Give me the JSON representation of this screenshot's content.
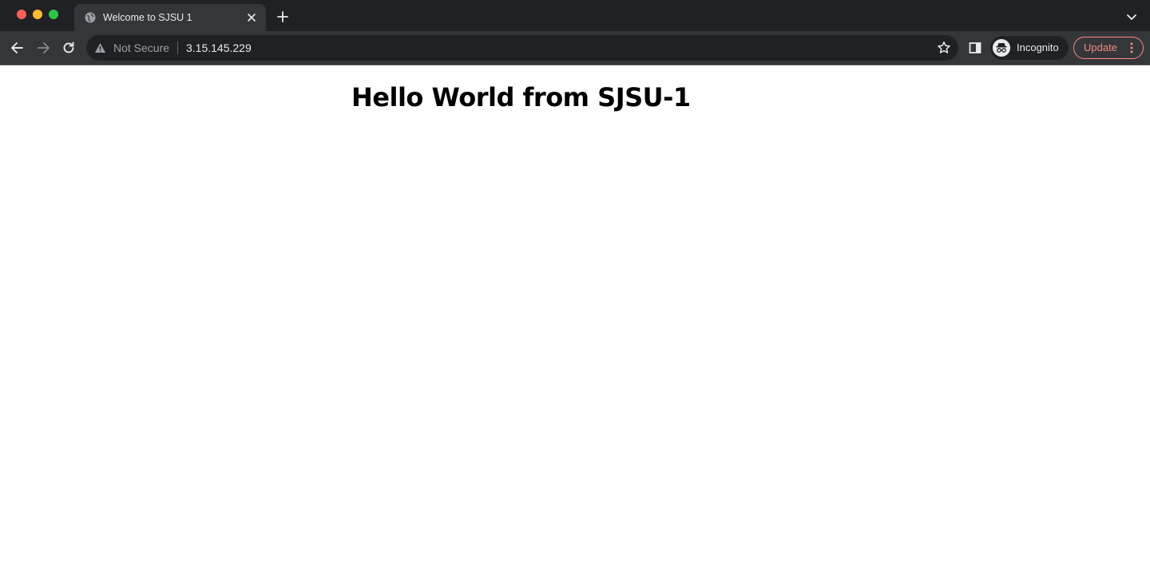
{
  "window": {
    "controls": [
      "close",
      "minimize",
      "maximize"
    ]
  },
  "tab": {
    "title": "Welcome to SJSU 1",
    "favicon": "globe-icon"
  },
  "omnibox": {
    "security_label": "Not Secure",
    "url": "3.15.145.229"
  },
  "profile": {
    "label": "Incognito"
  },
  "update_button": {
    "label": "Update"
  },
  "page": {
    "heading": "Hello World from SJSU-1"
  },
  "colors": {
    "tabstrip_bg": "#202124",
    "toolbar_bg": "#35363a",
    "update_accent": "#f28b82",
    "close_dot": "#ff5f57",
    "minimize_dot": "#febc2e",
    "maximize_dot": "#28c840"
  }
}
